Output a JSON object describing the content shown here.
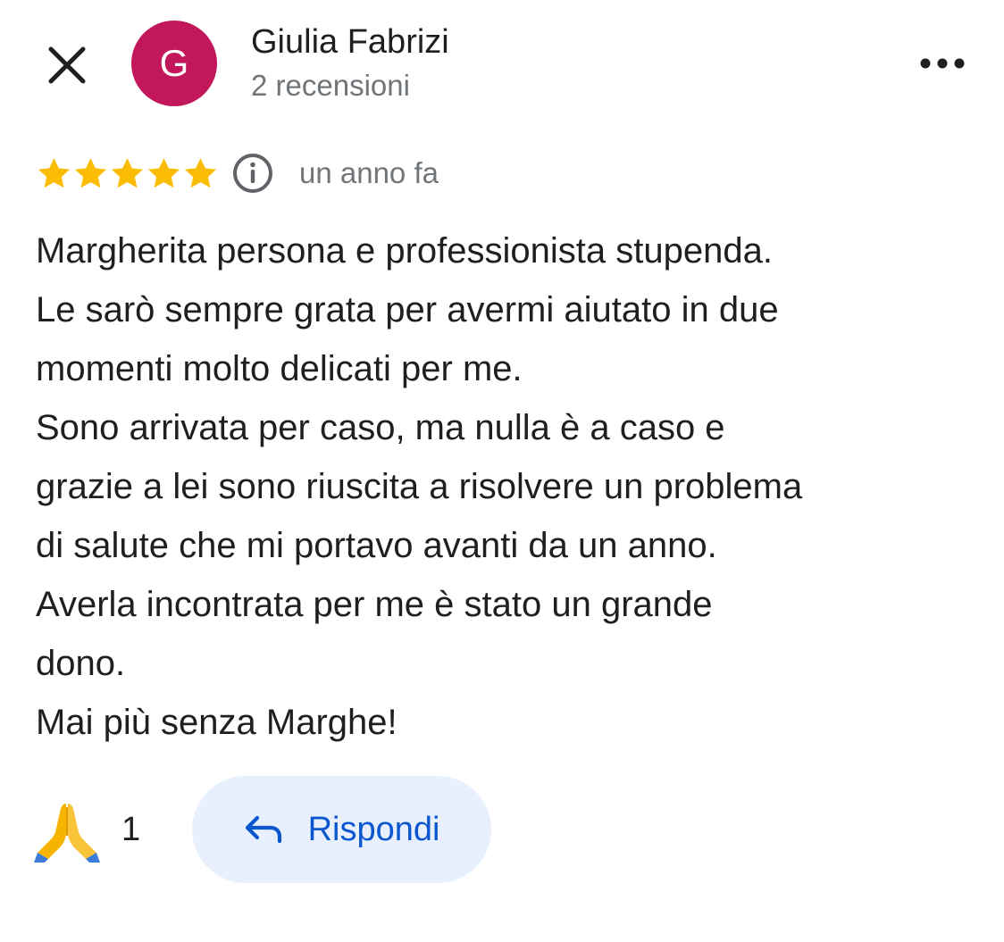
{
  "colors": {
    "avatar_bg": "#c2185b",
    "star": "#fbbc04",
    "accent": "#0b57d0",
    "reply_bg": "#e8f0fe",
    "secondary_text": "#70757a"
  },
  "header": {
    "close_icon": "close-icon",
    "avatar_letter": "G",
    "author_name": "Giulia Fabrizi",
    "review_count": "2 recensioni",
    "more_icon": "more-horizontal-icon"
  },
  "review": {
    "rating": 5,
    "rating_max": 5,
    "info_icon": "info-icon",
    "time_ago": "un anno fa",
    "text": "Margherita persona e professionista stupenda.\nLe sarò sempre grata per avermi aiutato in due\nmomenti molto delicati per me.\nSono arrivata per caso, ma nulla è a caso e\ngrazie a lei sono riuscita a risolvere un problema\ndi salute che mi portavo avanti da un anno.\nAverla incontrata per me è stato un grande\ndono.\nMai più senza Marghe!"
  },
  "actions": {
    "reaction_icon": "folded-hands-icon",
    "reaction_count": "1",
    "reply_icon": "reply-arrow-icon",
    "reply_label": "Rispondi"
  }
}
